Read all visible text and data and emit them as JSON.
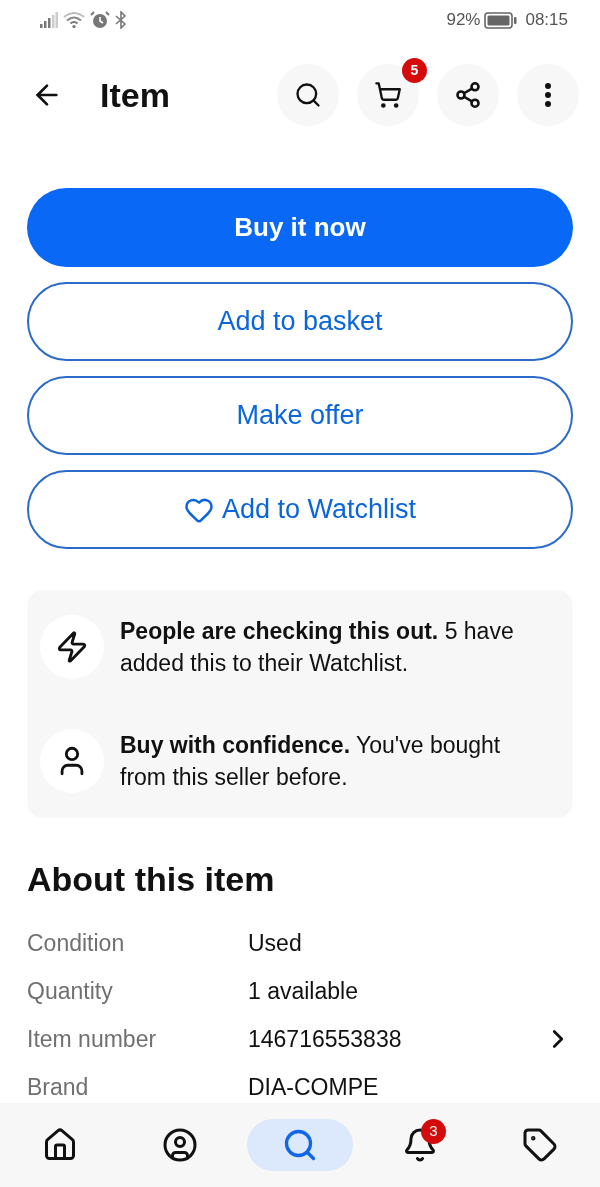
{
  "status_bar": {
    "battery": "92%",
    "time": "08:15"
  },
  "header": {
    "title": "Item",
    "actions": [
      {
        "kind": "search"
      },
      {
        "kind": "cart",
        "badge": "5"
      },
      {
        "kind": "share"
      },
      {
        "kind": "more"
      }
    ]
  },
  "buttons": [
    {
      "label": "Buy it now",
      "kind": "primary"
    },
    {
      "label": "Add to basket",
      "kind": "outline"
    },
    {
      "label": "Make offer",
      "kind": "outline"
    },
    {
      "label": "Add to Watchlist",
      "kind": "watch"
    }
  ],
  "highlights": [
    {
      "kind": "trending",
      "text": "**People are checking this out.** 5 have added this to their Watchlist."
    },
    {
      "kind": "seller",
      "text": "**Buy with confidence.** You've bought from this seller before."
    }
  ],
  "about": {
    "title": "About this item",
    "rows": [
      {
        "label": "Condition",
        "value": "Used",
        "has_details": false
      },
      {
        "label": "Quantity",
        "value": "1 available",
        "has_details": false
      },
      {
        "label": "Item number",
        "value": "146716553838",
        "has_details": true
      },
      {
        "label": "Brand",
        "value": "DIA-COMPE",
        "has_details": false
      }
    ]
  },
  "bottom_nav": [
    {
      "kind": "home",
      "selected": false
    },
    {
      "kind": "account",
      "selected": false
    },
    {
      "kind": "search",
      "selected": true
    },
    {
      "kind": "notifications",
      "selected": false,
      "badge": "3"
    },
    {
      "kind": "selling",
      "selected": false
    }
  ]
}
